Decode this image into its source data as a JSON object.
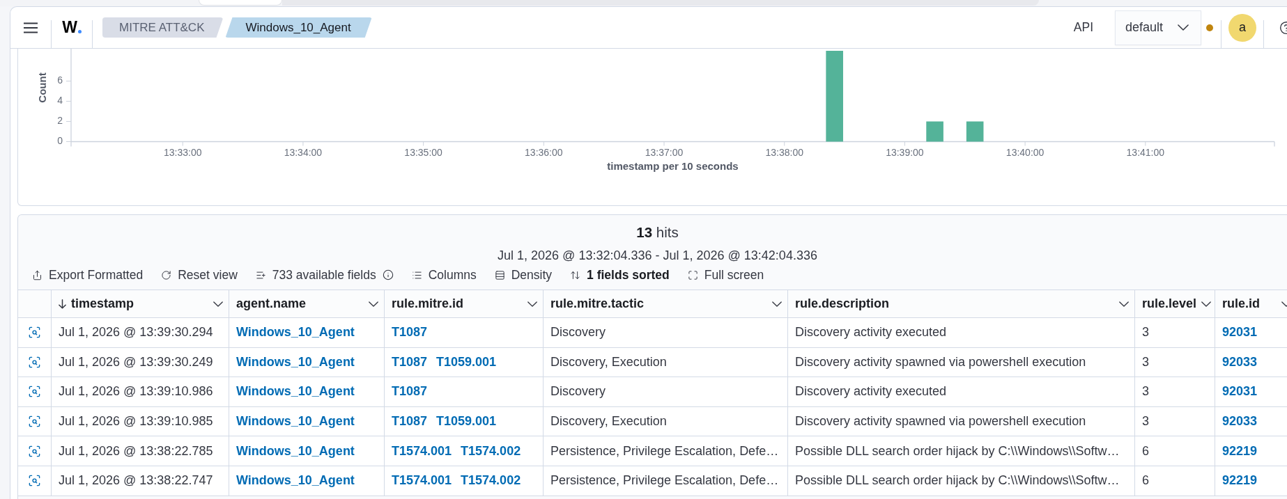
{
  "header": {
    "logo": "W",
    "breadcrumbs": [
      {
        "label": "MITRE ATT&CK",
        "selected": false
      },
      {
        "label": "Windows_10_Agent",
        "selected": true
      }
    ],
    "api_link": "API",
    "space_select": {
      "value": "default"
    },
    "avatar": {
      "initial": "a"
    }
  },
  "histogram": {
    "chart_data": {
      "type": "bar",
      "xlabel": "timestamp per 10 seconds",
      "ylabel": "Count",
      "x": [
        49105,
        49155,
        49175
      ],
      "values": [
        9,
        2,
        2
      ],
      "xlim": [
        48724.336,
        49324.336
      ],
      "ylim": [
        0,
        9
      ],
      "xticks": [
        {
          "value": 48780,
          "label": "13:33:00"
        },
        {
          "value": 48840,
          "label": "13:34:00"
        },
        {
          "value": 48900,
          "label": "13:35:00"
        },
        {
          "value": 48960,
          "label": "13:36:00"
        },
        {
          "value": 49020,
          "label": "13:37:00"
        },
        {
          "value": 49080,
          "label": "13:38:00"
        },
        {
          "value": 49140,
          "label": "13:39:00"
        },
        {
          "value": 49200,
          "label": "13:40:00"
        },
        {
          "value": 49260,
          "label": "13:41:00"
        }
      ],
      "yticks": [
        0,
        2,
        4,
        6
      ]
    }
  },
  "results": {
    "hits": "**13** hits",
    "time_range": "Jul 1, 2026 @ 13:32:04.336 - Jul 1, 2026 @ 13:42:04.336",
    "toolbar": [
      {
        "kind": "export",
        "label": "Export Formatted"
      },
      {
        "kind": "reset",
        "label": "Reset view"
      },
      {
        "kind": "fields",
        "label": "733 available fields"
      },
      {
        "kind": "columns",
        "label": "Columns"
      },
      {
        "kind": "density",
        "label": "Density"
      },
      {
        "kind": "sort",
        "label": "1 fields sorted"
      },
      {
        "kind": "fullscreen",
        "label": "Full screen"
      }
    ],
    "table": {
      "columns": [
        {
          "label": "timestamp",
          "kind": "time",
          "sorted": true
        },
        {
          "label": "agent.name",
          "kind": "link",
          "sorted": false
        },
        {
          "label": "rule.mitre.id",
          "kind": "link_list",
          "sorted": false
        },
        {
          "label": "rule.mitre.tactic",
          "kind": "text",
          "sorted": false
        },
        {
          "label": "rule.description",
          "kind": "text",
          "sorted": false
        },
        {
          "label": "rule.level",
          "kind": "text",
          "sorted": false
        },
        {
          "label": "rule.id",
          "kind": "link",
          "sorted": false
        }
      ],
      "rows": [
        {
          "cells": [
            "Jul 1, 2026 @ 13:39:30.294",
            "Windows_10_Agent",
            [
              "T1087"
            ],
            "Discovery",
            "Discovery activity executed",
            "3",
            "92031"
          ]
        },
        {
          "cells": [
            "Jul 1, 2026 @ 13:39:30.249",
            "Windows_10_Agent",
            [
              "T1087",
              "T1059.001"
            ],
            "Discovery, Execution",
            "Discovery activity spawned via powershell execution",
            "3",
            "92033"
          ]
        },
        {
          "cells": [
            "Jul 1, 2026 @ 13:39:10.986",
            "Windows_10_Agent",
            [
              "T1087"
            ],
            "Discovery",
            "Discovery activity executed",
            "3",
            "92031"
          ]
        },
        {
          "cells": [
            "Jul 1, 2026 @ 13:39:10.985",
            "Windows_10_Agent",
            [
              "T1087",
              "T1059.001"
            ],
            "Discovery, Execution",
            "Discovery activity spawned via powershell execution",
            "3",
            "92033"
          ]
        },
        {
          "cells": [
            "Jul 1, 2026 @ 13:38:22.785",
            "Windows_10_Agent",
            [
              "T1574.001",
              "T1574.002"
            ],
            "Persistence, Privilege Escalation, Defe…",
            "Possible DLL search order hijack by C:\\\\Windows\\\\Softw…",
            "6",
            "92219"
          ]
        },
        {
          "cells": [
            "Jul 1, 2026 @ 13:38:22.747",
            "Windows_10_Agent",
            [
              "T1574.001",
              "T1574.002"
            ],
            "Persistence, Privilege Escalation, Defe…",
            "Possible DLL search order hijack by C:\\\\Windows\\\\Softw…",
            "6",
            "92219"
          ]
        }
      ]
    }
  }
}
